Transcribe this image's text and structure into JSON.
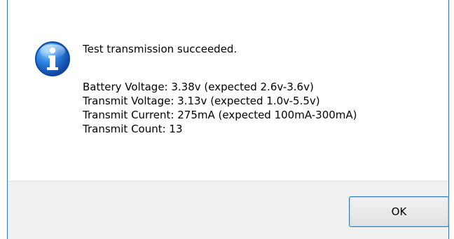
{
  "dialog": {
    "icon": "information-icon",
    "title_message": "Test transmission succeeded.",
    "details": [
      "Battery Voltage: 3.38v (expected 2.6v-3.6v)",
      "Transmit Voltage: 3.13v (expected 1.0v-5.5v)",
      "Transmit Current: 275mA (expected 100mA-300mA)",
      "Transmit Count: 13"
    ],
    "ok_label": "OK"
  },
  "colors": {
    "dialog_edge": "#2f6fd0",
    "footer_background": "#f0f0f0",
    "button_border": "#3c7fb1",
    "icon_blue": "#1f65c7"
  }
}
